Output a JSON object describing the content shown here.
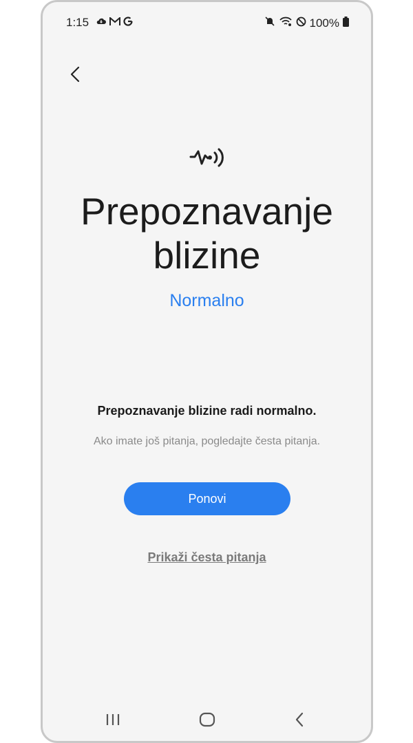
{
  "status_bar": {
    "time": "1:15",
    "left_icons": [
      "cloud-icon",
      "gmail-icon",
      "google-icon"
    ],
    "battery": "100%",
    "right_icons": [
      "mute-icon",
      "wifi-icon",
      "do-not-disturb-icon",
      "battery-icon"
    ]
  },
  "header": {
    "back_icon": "back-arrow-icon",
    "feature_icon": "proximity-sensor-icon",
    "title": "Prepoznavanje blizine",
    "status": "Normalno"
  },
  "body": {
    "message": "Prepoznavanje blizine radi normalno.",
    "hint": "Ako imate još pitanja, pogledajte česta pitanja."
  },
  "actions": {
    "retry_label": "Ponovi",
    "faq_label": "Prikaži česta pitanja"
  },
  "nav_bar": {
    "items": [
      "recent-apps-icon",
      "home-icon",
      "back-icon"
    ]
  },
  "colors": {
    "accent": "#2a7fef",
    "background": "#f5f5f5",
    "title_text": "#1c1c1c",
    "hint_text": "#8a8a8a"
  }
}
